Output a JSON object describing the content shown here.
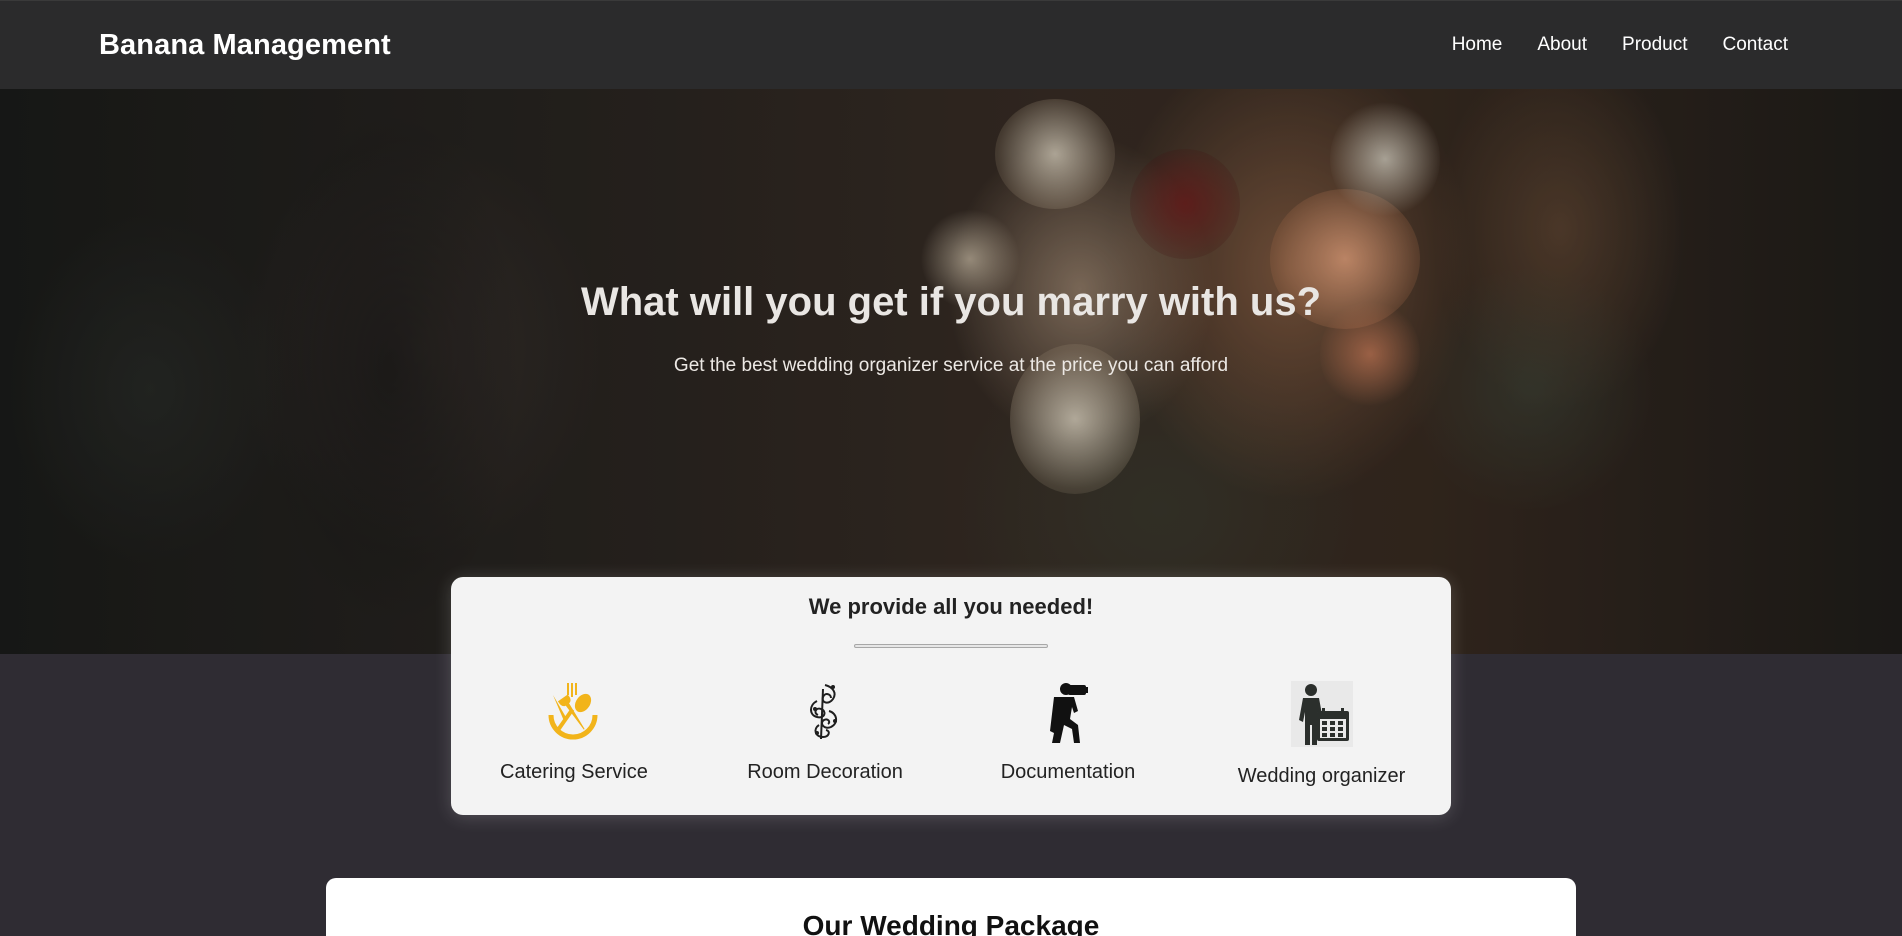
{
  "navbar": {
    "brand": "Banana Management",
    "links": [
      {
        "label": "Home"
      },
      {
        "label": "About"
      },
      {
        "label": "Product"
      },
      {
        "label": "Contact"
      }
    ]
  },
  "hero": {
    "title": "What will you get if you marry with us?",
    "subtitle": "Get the best wedding organizer service at the price you can afford"
  },
  "services": {
    "title": "We provide all you needed!",
    "items": [
      {
        "label": "Catering Service",
        "icon": "catering-icon",
        "color": "#f2b41a"
      },
      {
        "label": "Room Decoration",
        "icon": "decoration-icon",
        "color": "#1e1e1e"
      },
      {
        "label": "Documentation",
        "icon": "camera-photographer-icon",
        "color": "#111111"
      },
      {
        "label": "Wedding organizer",
        "icon": "organizer-calendar-icon",
        "color": "#2b2f2c"
      }
    ]
  },
  "packages": {
    "title": "Our Wedding Package"
  },
  "colors": {
    "navbar_bg": "#2b2b2c",
    "page_bg": "#2f2c33",
    "card_bg": "#f3f3f3",
    "accent": "#f2b41a"
  }
}
